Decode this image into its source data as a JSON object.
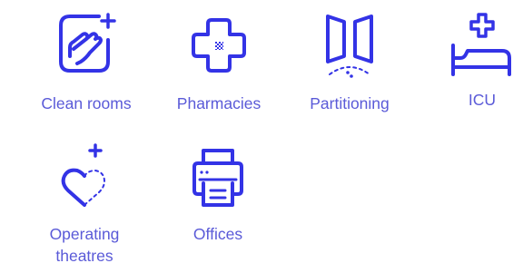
{
  "colors": {
    "accent": "#3333E6",
    "label": "#5A5AD8"
  },
  "items": [
    {
      "label": "Clean rooms",
      "icon": "cleaning-hand-icon"
    },
    {
      "label": "Pharmacies",
      "icon": "medical-cross-icon"
    },
    {
      "label": "Partitioning",
      "icon": "partition-doors-icon"
    },
    {
      "label": "ICU",
      "icon": "hospital-bed-icon"
    },
    {
      "label": "Operating\ntheatres",
      "icon": "heart-icon"
    },
    {
      "label": "Offices",
      "icon": "printer-icon"
    }
  ]
}
